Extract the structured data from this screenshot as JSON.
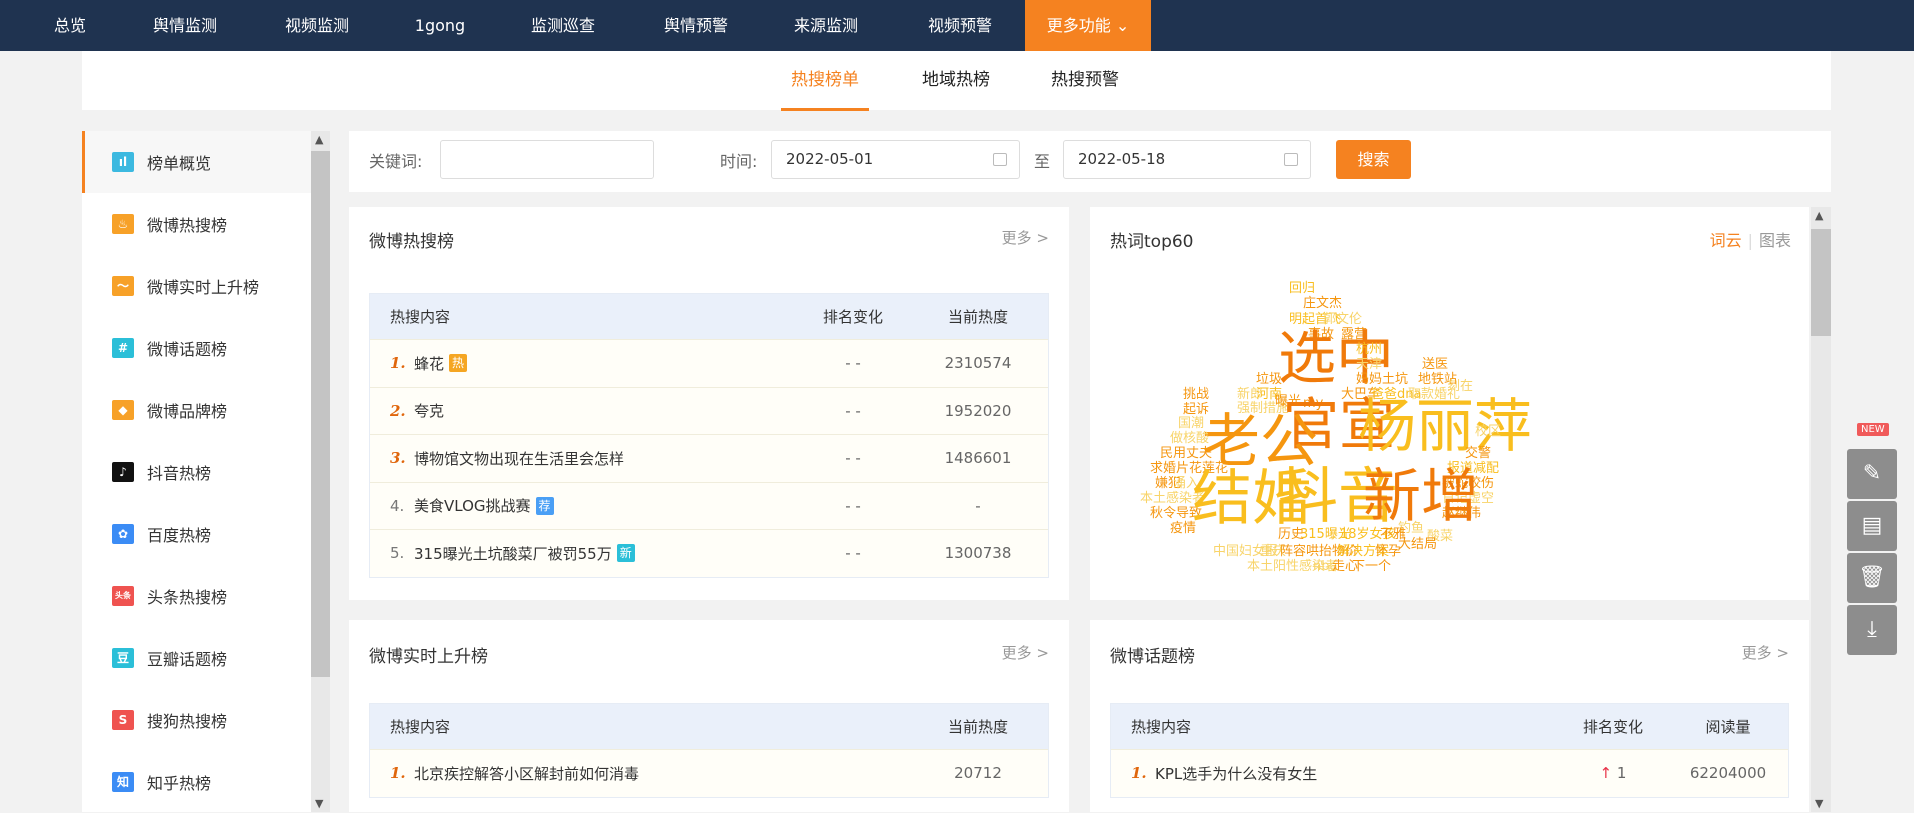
{
  "topnav": {
    "items": [
      "总览",
      "舆情监测",
      "视频监测",
      "1gong",
      "监测巡查",
      "舆情预警",
      "来源监测",
      "视频预警"
    ],
    "more": "更多功能"
  },
  "subtabs": [
    "热搜榜单",
    "地域热榜",
    "热搜预警"
  ],
  "sidebar": {
    "items": [
      {
        "label": "榜单概览",
        "icon": "bar-chart-icon",
        "color": "#3cb9e0",
        "glyph": "ıl"
      },
      {
        "label": "微博热搜榜",
        "icon": "fire-icon",
        "color": "#f7a128",
        "glyph": "♨"
      },
      {
        "label": "微博实时上升榜",
        "icon": "trend-icon",
        "color": "#f7a128",
        "glyph": "〜"
      },
      {
        "label": "微博话题榜",
        "icon": "topic-bubble-icon",
        "color": "#2bbfd8",
        "glyph": "#"
      },
      {
        "label": "微博品牌榜",
        "icon": "diamond-icon",
        "color": "#f7a128",
        "glyph": "◆"
      },
      {
        "label": "抖音热榜",
        "icon": "tiktok-icon",
        "color": "#111111",
        "glyph": "♪"
      },
      {
        "label": "百度热榜",
        "icon": "baidu-paw-icon",
        "color": "#3b8cf5",
        "glyph": "✿"
      },
      {
        "label": "头条热搜榜",
        "icon": "toutiao-icon",
        "color": "#ef5350",
        "glyph": "头条"
      },
      {
        "label": "豆瓣话题榜",
        "icon": "douban-icon",
        "color": "#2bbfd8",
        "glyph": "豆"
      },
      {
        "label": "搜狗热搜榜",
        "icon": "sogou-icon",
        "color": "#ef5350",
        "glyph": "S"
      },
      {
        "label": "知乎热榜",
        "icon": "zhihu-icon",
        "color": "#3b8cf5",
        "glyph": "知"
      }
    ]
  },
  "search": {
    "keyword_label": "关键词:",
    "keyword_value": "",
    "time_label": "时间:",
    "start": "2022-05-01",
    "to": "至",
    "end": "2022-05-18",
    "button": "搜索"
  },
  "weibo_hot": {
    "title": "微博热搜榜",
    "more": "更多 >",
    "headers": [
      "热搜内容",
      "排名变化",
      "当前热度"
    ],
    "rows": [
      {
        "rank": "1.",
        "text": "蜂花",
        "badge": "热",
        "badge_color": "#f5a623",
        "change": "- -",
        "value": "2310574",
        "top": true
      },
      {
        "rank": "2.",
        "text": "夸克",
        "badge": "",
        "change": "- -",
        "value": "1952020",
        "top": true
      },
      {
        "rank": "3.",
        "text": "博物馆文物出现在生活里会怎样",
        "badge": "",
        "change": "- -",
        "value": "1486601",
        "top": true
      },
      {
        "rank": "4.",
        "text": "美食VLOG挑战赛",
        "badge": "荐",
        "badge_color": "#4a9ff5",
        "change": "- -",
        "value": "-",
        "top": false
      },
      {
        "rank": "5.",
        "text": "315曝光土坑酸菜厂被罚55万",
        "badge": "新",
        "badge_color": "#2bbfd8",
        "change": "- -",
        "value": "1300738",
        "top": false
      }
    ]
  },
  "wordcloud": {
    "title": "热词top60",
    "tab_cloud": "词云",
    "tab_chart": "图表",
    "words": [
      {
        "t": "回归",
        "w": 13,
        "c": 2
      },
      {
        "t": "庄文杰",
        "w": 13,
        "c": 1
      },
      {
        "t": "明起首飞",
        "w": 13,
        "c": 2
      },
      {
        "t": "郭文伦",
        "w": 13,
        "c": 3
      },
      {
        "t": "事故",
        "w": 13,
        "c": 1
      },
      {
        "t": "露营",
        "w": 13,
        "c": 1
      },
      {
        "t": "选中",
        "w": 58,
        "c": 0
      },
      {
        "t": "杭州",
        "w": 13,
        "c": 2
      },
      {
        "t": "天津",
        "w": 13,
        "c": 3
      },
      {
        "t": "妈妈土坑",
        "w": 13,
        "c": 1
      },
      {
        "t": "送医",
        "w": 13,
        "c": 1
      },
      {
        "t": "地铁站",
        "w": 13,
        "c": 1
      },
      {
        "t": "垃圾",
        "w": 13,
        "c": 1
      },
      {
        "t": "大巴车",
        "w": 13,
        "c": 1
      },
      {
        "t": "爸爸dna",
        "w": 13,
        "c": 2
      },
      {
        "t": "取款婚礼",
        "w": 13,
        "c": 3
      },
      {
        "t": "刻在",
        "w": 13,
        "c": 3
      },
      {
        "t": "挑战",
        "w": 13,
        "c": 1
      },
      {
        "t": "起诉",
        "w": 13,
        "c": 1
      },
      {
        "t": "新郎",
        "w": 13,
        "c": 3
      },
      {
        "t": "河南",
        "w": 13,
        "c": 2
      },
      {
        "t": "强制措施",
        "w": 13,
        "c": 3
      },
      {
        "t": "曝光",
        "w": 13,
        "c": 1
      },
      {
        "t": "my",
        "w": 13,
        "c": 1
      },
      {
        "t": "官宣",
        "w": 56,
        "c": 0
      },
      {
        "t": "杨丽萍",
        "w": 58,
        "c": 2
      },
      {
        "t": "老公",
        "w": 58,
        "c": 1
      },
      {
        "t": "国潮",
        "w": 13,
        "c": 3
      },
      {
        "t": "做核酸",
        "w": 13,
        "c": 3
      },
      {
        "t": "民用丈夫",
        "w": 13,
        "c": 1
      },
      {
        "t": "求婚片花莲花",
        "w": 13,
        "c": 1
      },
      {
        "t": "嫌犯",
        "w": 13,
        "c": 1
      },
      {
        "t": "涌入",
        "w": 13,
        "c": 3
      },
      {
        "t": "本土感染者",
        "w": 13,
        "c": 3
      },
      {
        "t": "秋令导致",
        "w": 13,
        "c": 1
      },
      {
        "t": "疫情",
        "w": 13,
        "c": 1
      },
      {
        "t": "校区",
        "w": 13,
        "c": 3
      },
      {
        "t": "交警",
        "w": 13,
        "c": 1
      },
      {
        "t": "报道减配",
        "w": 13,
        "c": 2
      },
      {
        "t": "被蛇咬伤",
        "w": 13,
        "c": 1
      },
      {
        "t": "日记虚空",
        "w": 13,
        "c": 3
      },
      {
        "t": "赵继伟",
        "w": 13,
        "c": 1
      },
      {
        "t": "结婚",
        "w": 60,
        "c": 2
      },
      {
        "t": "抖音",
        "w": 60,
        "c": 2
      },
      {
        "t": "新增",
        "w": 58,
        "c": 0
      },
      {
        "t": "钓鱼",
        "w": 13,
        "c": 3
      },
      {
        "t": "酸菜",
        "w": 13,
        "c": 3
      },
      {
        "t": "大结局",
        "w": 13,
        "c": 1
      },
      {
        "t": "历史",
        "w": 13,
        "c": 1
      },
      {
        "t": "315曝光",
        "w": 13,
        "c": 2
      },
      {
        "t": "18岁女孩",
        "w": 13,
        "c": 2
      },
      {
        "t": "不雅",
        "w": 13,
        "c": 1
      },
      {
        "t": "中国妇女报",
        "w": 13,
        "c": 3
      },
      {
        "t": "重庆",
        "w": 13,
        "c": 3
      },
      {
        "t": "阵容哄抬物价",
        "w": 13,
        "c": 1
      },
      {
        "t": "解决方案",
        "w": 13,
        "c": 2
      },
      {
        "t": "怀孕",
        "w": 13,
        "c": 1
      },
      {
        "t": "本土阳性感染者",
        "w": 13,
        "c": 3
      },
      {
        "t": "nba",
        "w": 13,
        "c": 3
      },
      {
        "t": "走心",
        "w": 13,
        "c": 1
      },
      {
        "t": "下一个",
        "w": 13,
        "c": 1
      }
    ],
    "palette": [
      "#f07a0a",
      "#f5960f",
      "#f9be1e",
      "#f8d46a"
    ]
  },
  "weibo_rise": {
    "title": "微博实时上升榜",
    "more": "更多 >",
    "headers": [
      "热搜内容",
      "当前热度"
    ],
    "rows": [
      {
        "rank": "1.",
        "text": "北京疾控解答小区解封前如何消毒",
        "value": "20712"
      }
    ]
  },
  "weibo_topic": {
    "title": "微博话题榜",
    "more": "更多 >",
    "headers": [
      "热搜内容",
      "排名变化",
      "阅读量"
    ],
    "rows": [
      {
        "rank": "1.",
        "text": "KPL选手为什么没有女生",
        "change_icon": "↑",
        "change": "1",
        "value": "62204000"
      }
    ]
  },
  "float": {
    "new": "NEW",
    "buttons": [
      {
        "icon": "feedback-icon",
        "glyph": "✎"
      },
      {
        "icon": "document-icon",
        "glyph": "▤"
      },
      {
        "icon": "trash-icon",
        "glyph": "🗑"
      },
      {
        "icon": "download-icon",
        "glyph": "⤓"
      }
    ]
  }
}
